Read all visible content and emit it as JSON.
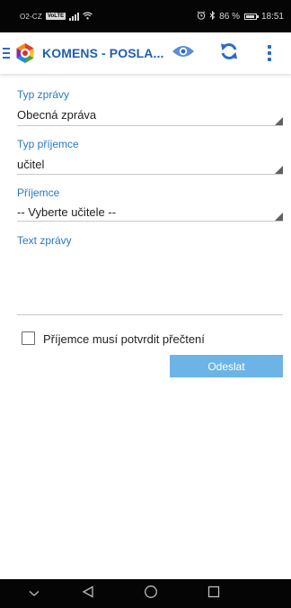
{
  "status_bar": {
    "carrier": "O2-CZ",
    "network_badge": "VoLTE",
    "alarm_icon": "alarm-icon",
    "bluetooth_icon": "bluetooth-icon",
    "battery_percent": "86 %",
    "time": "18:51"
  },
  "app_bar": {
    "title": "KOMENS - POSLA...",
    "menu_icon": "menu-icon",
    "preview_icon": "eye-icon",
    "refresh_icon": "refresh-icon",
    "overflow_icon": "overflow-menu-icon",
    "accent_color": "#2a6bc7"
  },
  "form": {
    "message_type": {
      "label": "Typ zprávy",
      "value": "Obecná zpráva"
    },
    "recipient_type": {
      "label": "Typ příjemce",
      "value": "učitel"
    },
    "recipient": {
      "label": "Příjemce",
      "value": "-- Vyberte učitele --"
    },
    "message_text": {
      "label": "Text zprávy",
      "value": ""
    },
    "confirm_read": {
      "label": "Příjemce musí potvrdit přečtení",
      "checked": false
    },
    "send_label": "Odeslat",
    "label_color": "#2a78c8",
    "button_color": "#6db4e6"
  },
  "nav_bar": {
    "back_icon": "back-triangle-icon",
    "home_icon": "home-circle-icon",
    "recents_icon": "recents-square-icon",
    "collapse_icon": "chevron-down-icon"
  }
}
